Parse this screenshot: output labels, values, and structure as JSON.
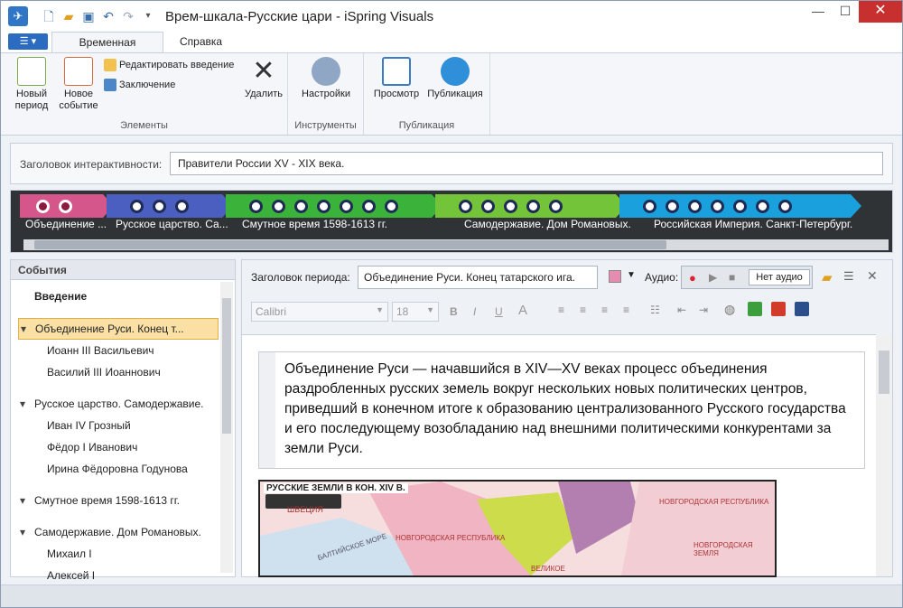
{
  "window": {
    "title": "Врем-шкала-Русские цари - iSpring Visuals"
  },
  "tabs": [
    "Временная шкала",
    "Справка"
  ],
  "ribbon": {
    "new_period": "Новый период",
    "new_event": "Новое событие",
    "edit_intro": "Редактировать введение",
    "conclusion": "Заключение",
    "delete": "Удалить",
    "group_elements": "Элементы",
    "settings": "Настройки",
    "group_tools": "Инструменты",
    "preview": "Просмотр",
    "publish": "Публикация",
    "group_publish": "Публикация"
  },
  "header": {
    "label": "Заголовок интерактивности:",
    "value": "Правители России XV - XIX века."
  },
  "timeline": {
    "bands": [
      {
        "label": "Объединение ...",
        "color": "#d4568a",
        "dots": 2
      },
      {
        "label": "Русское царство. Са...",
        "color": "#4a5fc0",
        "dots": 3
      },
      {
        "label": "Смутное время 1598-1613 гг.",
        "color": "#3bb33b",
        "dots": 7
      },
      {
        "label": "Самодержавие. Дом Романовых.",
        "color": "#74c43a",
        "dots": 5
      },
      {
        "label": "Российская Империя. Санкт-Петербург.",
        "color": "#1aa0dc",
        "dots": 7
      }
    ]
  },
  "events": {
    "title": "События",
    "items": [
      {
        "label": "Введение",
        "bold": true,
        "indent": 0
      },
      {
        "label": "Объединение Руси. Конец т...",
        "selected": true,
        "indent": 1
      },
      {
        "label": "Иоанн III Васильевич",
        "indent": 2
      },
      {
        "label": "Василий III Иоаннович",
        "indent": 2
      },
      {
        "label": "Русское царство. Самодержавие.",
        "indent": 1
      },
      {
        "label": "Иван IV Грозный",
        "indent": 2
      },
      {
        "label": "Фёдор I Иванович",
        "indent": 2
      },
      {
        "label": "Ирина Фёдоровна Годунова",
        "indent": 2
      },
      {
        "label": "Смутное время 1598-1613 гг.",
        "indent": 1
      },
      {
        "label": "Самодержавие. Дом Романовых.",
        "indent": 1
      },
      {
        "label": "Михаил I",
        "indent": 2
      },
      {
        "label": "Алексей I",
        "indent": 2
      }
    ]
  },
  "editor": {
    "period_label": "Заголовок периода:",
    "period_value": "Объединение Руси. Конец татарского ига.",
    "audio_label": "Аудио:",
    "no_audio": "Нет аудио",
    "font": "Calibri",
    "size": "18",
    "text": "Объединение Руси — начавшийся в XIV—XV веках процесс объединения раздробленных русских земель вокруг нескольких новых политических центров, приведший в конечном итоге к образованию централизованного Русского государства и его последующему возобладанию над внешними политическими конкурентами за земли Руси.",
    "map_title": "РУССКИЕ ЗЕМЛИ В КОН. XIV В.",
    "map_labels": [
      "ШВЕЦИЯ",
      "БАЛТИЙСКОЕ МОРЕ",
      "НОВГОРОДСКАЯ РЕСПУБЛИКА",
      "НОВГОРОДСКАЯ РЕСПУБЛИКА",
      "НОВГОРОДСКАЯ ЗЕМЛЯ",
      "ВЕЛИКОЕ"
    ]
  }
}
